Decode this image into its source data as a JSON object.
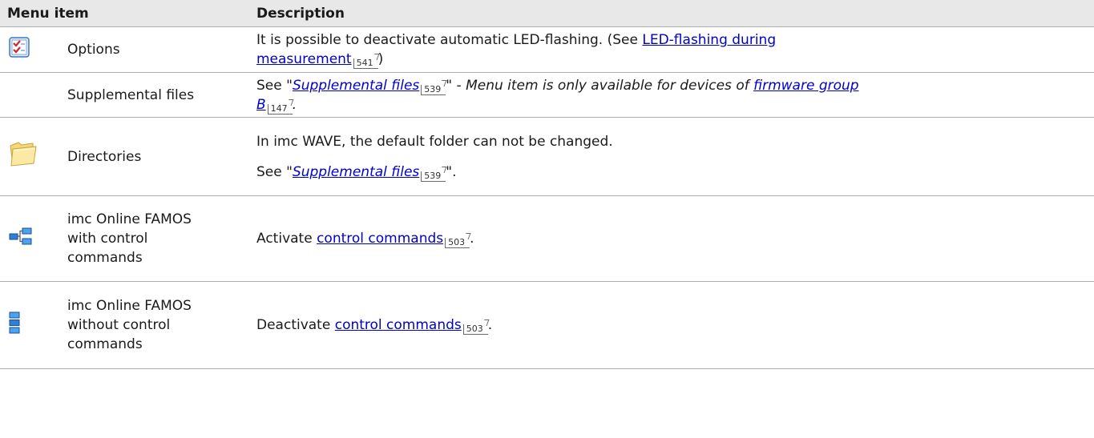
{
  "header": {
    "col_item": "Menu item",
    "col_desc": "Description"
  },
  "rows": [
    {
      "icon": "options-checklist-icon",
      "label": "Options",
      "desc": {
        "text1": "It is possible to deactivate automatic LED-flashing. (See ",
        "link1a": "LED-flashing during",
        "link1b": "measurement",
        "ref": "541",
        "text2": ")"
      }
    },
    {
      "icon": "",
      "label": "Supplemental files",
      "desc": {
        "text1": "See \"",
        "link1": "Supplemental files",
        "ref1": "539",
        "text2": "\" - ",
        "italic": "Menu item is only available for devices of ",
        "link2a": "firmware group",
        "link2b": "B",
        "ref2": "147",
        "text3": "."
      }
    },
    {
      "icon": "folder-icon",
      "label": "Directories",
      "desc": {
        "line1": "In imc WAVE, the default folder can not be changed.",
        "text1": "See \"",
        "link1": "Supplemental files",
        "ref1": "539",
        "text2": "\"."
      }
    },
    {
      "icon": "control-commands-icon",
      "label_lines": [
        "imc Online FAMOS",
        "with control",
        "commands"
      ],
      "desc": {
        "text1": "Activate ",
        "link1": "control commands",
        "ref1": "503",
        "text2": "."
      }
    },
    {
      "icon": "stacked-blocks-icon",
      "label_lines": [
        "imc Online FAMOS",
        "without control",
        "commands"
      ],
      "desc": {
        "text1": "Deactivate ",
        "link1": "control commands",
        "ref1": "503",
        "text2": "."
      }
    }
  ],
  "colors": {
    "link": "#0000cc",
    "header_bg": "#e8e8e8",
    "rule": "#aeaeae"
  }
}
